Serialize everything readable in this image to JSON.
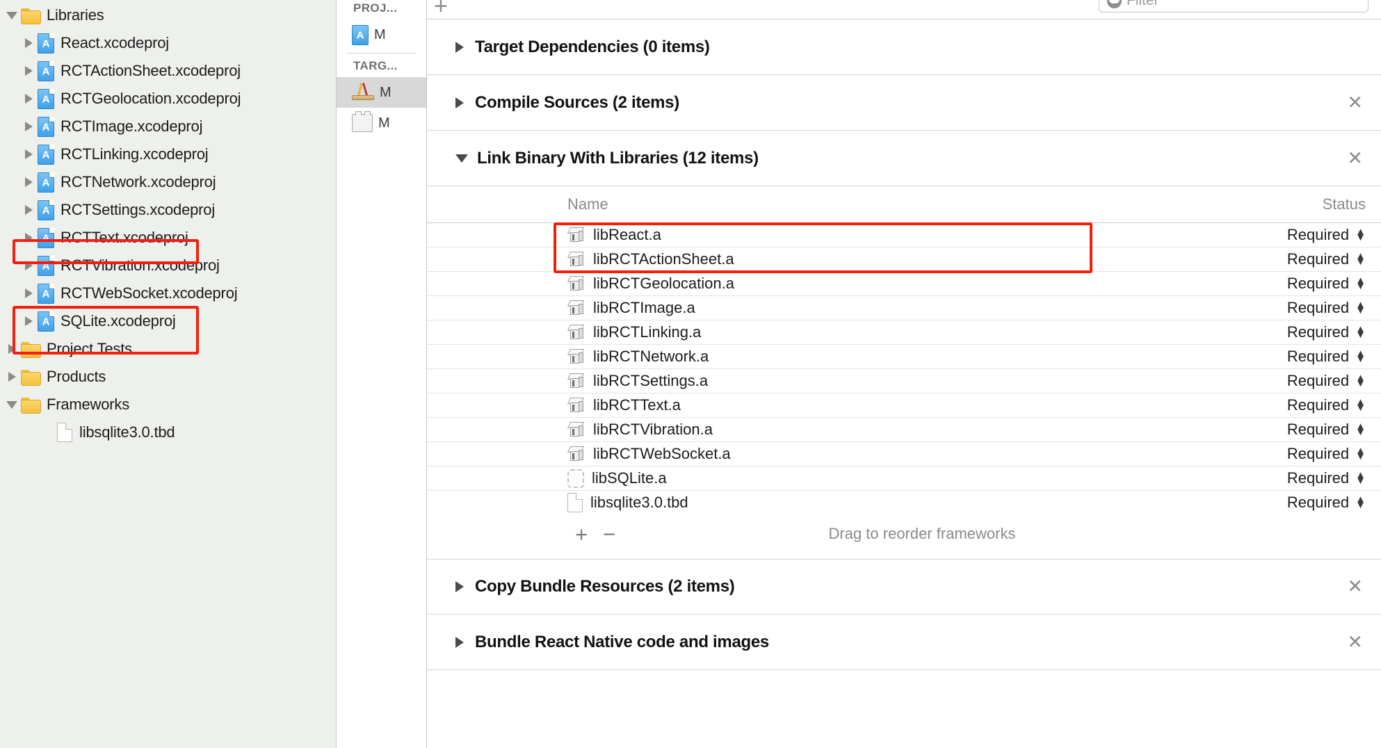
{
  "navigator": {
    "items": [
      {
        "label": "Libraries",
        "icon": "folder-icon",
        "indent": 0,
        "disclosure": "open"
      },
      {
        "label": "React.xcodeproj",
        "icon": "xcodeproj-icon",
        "indent": 1,
        "disclosure": "closed"
      },
      {
        "label": "RCTActionSheet.xcodeproj",
        "icon": "xcodeproj-icon",
        "indent": 1,
        "disclosure": "closed"
      },
      {
        "label": "RCTGeolocation.xcodeproj",
        "icon": "xcodeproj-icon",
        "indent": 1,
        "disclosure": "closed"
      },
      {
        "label": "RCTImage.xcodeproj",
        "icon": "xcodeproj-icon",
        "indent": 1,
        "disclosure": "closed"
      },
      {
        "label": "RCTLinking.xcodeproj",
        "icon": "xcodeproj-icon",
        "indent": 1,
        "disclosure": "closed"
      },
      {
        "label": "RCTNetwork.xcodeproj",
        "icon": "xcodeproj-icon",
        "indent": 1,
        "disclosure": "closed"
      },
      {
        "label": "RCTSettings.xcodeproj",
        "icon": "xcodeproj-icon",
        "indent": 1,
        "disclosure": "closed"
      },
      {
        "label": "RCTText.xcodeproj",
        "icon": "xcodeproj-icon",
        "indent": 1,
        "disclosure": "closed"
      },
      {
        "label": "RCTVibration.xcodeproj",
        "icon": "xcodeproj-icon",
        "indent": 1,
        "disclosure": "closed"
      },
      {
        "label": "RCTWebSocket.xcodeproj",
        "icon": "xcodeproj-icon",
        "indent": 1,
        "disclosure": "closed"
      },
      {
        "label": "SQLite.xcodeproj",
        "icon": "xcodeproj-icon",
        "indent": 1,
        "disclosure": "closed",
        "highlighted": true
      },
      {
        "label": "Project Tests",
        "icon": "folder-icon",
        "indent": 0,
        "disclosure": "closed"
      },
      {
        "label": "Products",
        "icon": "folder-icon",
        "indent": 0,
        "disclosure": "closed"
      },
      {
        "label": "Frameworks",
        "icon": "folder-icon",
        "indent": 0,
        "disclosure": "open",
        "highlighted": true
      },
      {
        "label": "libsqlite3.0.tbd",
        "icon": "file-icon",
        "indent": 2,
        "disclosure": "none",
        "highlighted": true
      }
    ]
  },
  "mini_pane": {
    "project_header": "PROJ...",
    "project_item": "M",
    "targets_header": "TARG...",
    "target_item": "M",
    "bundle_item": "M"
  },
  "editor": {
    "add_tab_label": "+",
    "filter_placeholder": "Filter",
    "sections": [
      {
        "title": "Target Dependencies (0 items)",
        "expanded": false,
        "closable": false
      },
      {
        "title": "Compile Sources (2 items)",
        "expanded": false,
        "closable": true
      },
      {
        "title": "Link Binary With Libraries (12 items)",
        "expanded": true,
        "closable": true
      },
      {
        "title": "Copy Bundle Resources (2 items)",
        "expanded": false,
        "closable": true
      },
      {
        "title": "Bundle React Native code and images",
        "expanded": false,
        "closable": true
      }
    ],
    "link_binary": {
      "columns": {
        "name": "Name",
        "status": "Status"
      },
      "rows": [
        {
          "name": "libReact.a",
          "status": "Required",
          "icon": "archive-icon"
        },
        {
          "name": "libRCTActionSheet.a",
          "status": "Required",
          "icon": "archive-icon"
        },
        {
          "name": "libRCTGeolocation.a",
          "status": "Required",
          "icon": "archive-icon"
        },
        {
          "name": "libRCTImage.a",
          "status": "Required",
          "icon": "archive-icon"
        },
        {
          "name": "libRCTLinking.a",
          "status": "Required",
          "icon": "archive-icon"
        },
        {
          "name": "libRCTNetwork.a",
          "status": "Required",
          "icon": "archive-icon"
        },
        {
          "name": "libRCTSettings.a",
          "status": "Required",
          "icon": "archive-icon"
        },
        {
          "name": "libRCTText.a",
          "status": "Required",
          "icon": "archive-icon"
        },
        {
          "name": "libRCTVibration.a",
          "status": "Required",
          "icon": "archive-icon"
        },
        {
          "name": "libRCTWebSocket.a",
          "status": "Required",
          "icon": "archive-icon"
        },
        {
          "name": "libSQLite.a",
          "status": "Required",
          "icon": "missing-file-icon",
          "highlighted": true
        },
        {
          "name": "libsqlite3.0.tbd",
          "status": "Required",
          "icon": "tbd-file-icon",
          "highlighted": true
        }
      ],
      "footer": {
        "add": "+",
        "remove": "−",
        "hint": "Drag to reorder frameworks"
      }
    }
  },
  "annotation": {
    "color": "#f21f0f",
    "boxes": [
      "sqlite-xcodeproj-row",
      "frameworks-folder-group",
      "sqlite-library-rows"
    ]
  }
}
